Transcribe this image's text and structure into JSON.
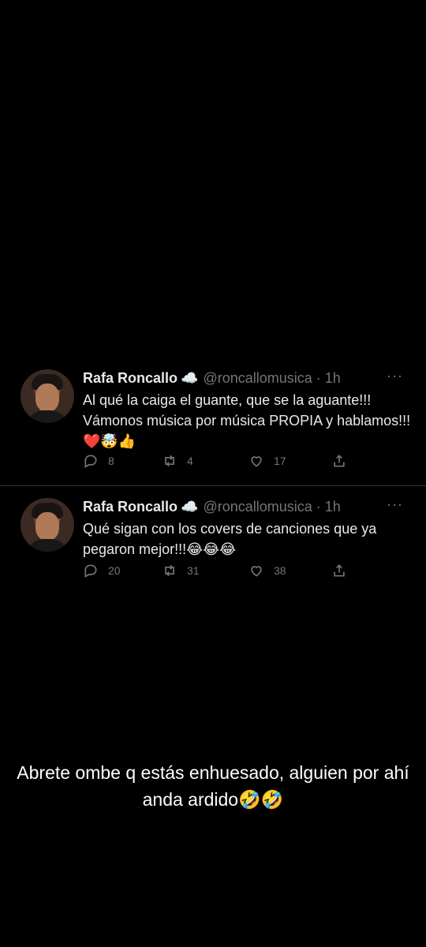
{
  "tweets": [
    {
      "author_name": "Rafa Roncallo",
      "badge_emoji": "☁️",
      "handle_time": "@roncallomusica · 1h",
      "more": "···",
      "text": "Al qué la caiga el guante, que se la aguante!!! Vámonos música por música PROPIA y hablamos!!!❤️🤯👍",
      "replies": "8",
      "retweets": "4",
      "likes": "17"
    },
    {
      "author_name": "Rafa Roncallo",
      "badge_emoji": "☁️",
      "handle_time": "@roncallomusica · 1h",
      "more": "···",
      "text": "Qué sigan con los covers de canciones que ya pegaron mejor!!!😂😂😂",
      "replies": "20",
      "retweets": "31",
      "likes": "38"
    }
  ],
  "caption": "Abrete ombe q estás enhuesado, alguien por ahí anda ardido🤣🤣",
  "icons": {
    "reply": "reply-icon",
    "retweet": "retweet-icon",
    "like": "heart-icon",
    "share": "share-icon"
  },
  "colors": {
    "background": "#000000",
    "text": "#e7e9ea",
    "secondary": "#71767b",
    "divider": "#2f3336"
  }
}
